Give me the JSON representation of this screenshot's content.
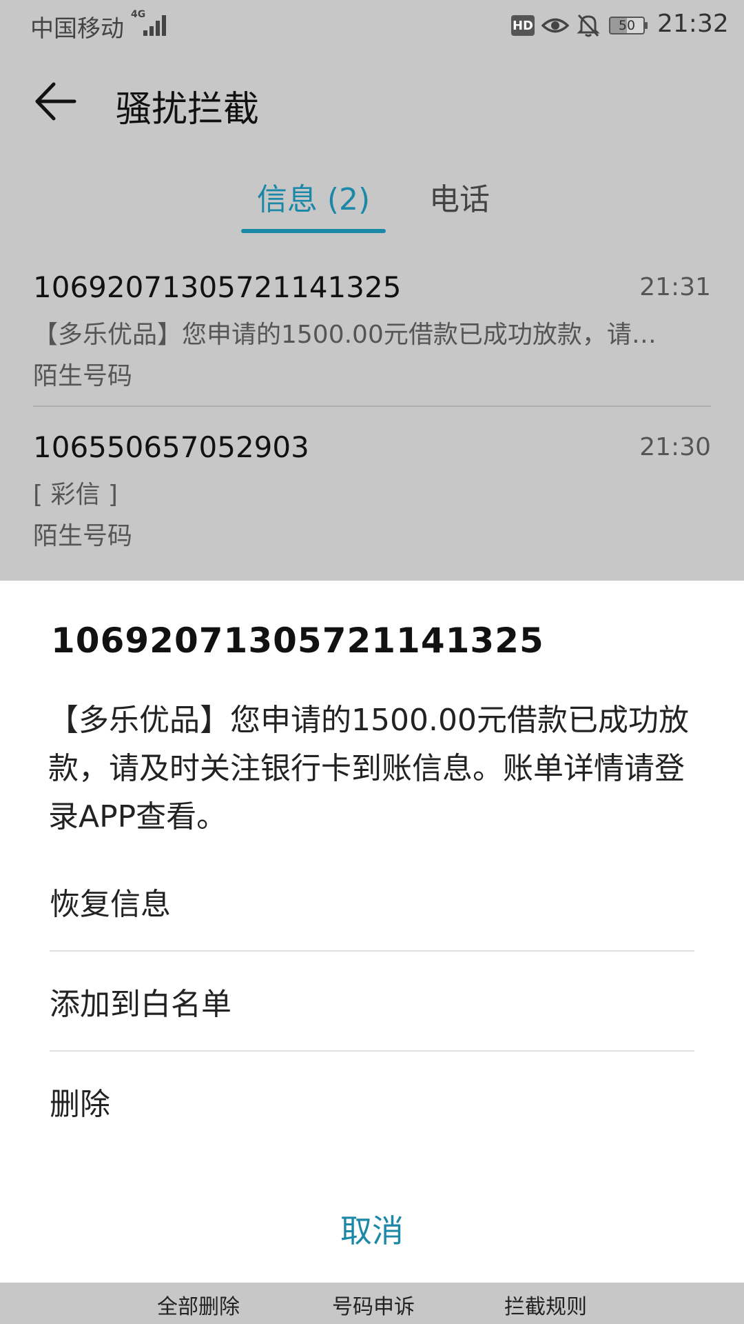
{
  "status_bar": {
    "carrier": "中国移动",
    "network": "4G",
    "hd": "HD",
    "battery_pct": "50",
    "battery_level": 0.5,
    "time": "21:32"
  },
  "app_bar": {
    "title": "骚扰拦截"
  },
  "tabs": [
    {
      "label": "信息 (2)",
      "active": true
    },
    {
      "label": "电话",
      "active": false
    }
  ],
  "messages": [
    {
      "sender": "10692071305721141325",
      "time": "21:31",
      "preview": "【多乐优品】您申请的1500.00元借款已成功放款，请…",
      "tag": "陌生号码"
    },
    {
      "sender": "106550657052903",
      "time": "21:30",
      "preview": "[ 彩信 ]",
      "tag": "陌生号码"
    }
  ],
  "sheet": {
    "sender": "10692071305721141325",
    "body": "【多乐优品】您申请的1500.00元借款已成功放款，请及时关注银行卡到账信息。账单详情请登录APP查看。",
    "options": [
      "恢复信息",
      "添加到白名单",
      "删除"
    ],
    "cancel": "取消"
  },
  "bottom_bar": {
    "actions": [
      "全部删除",
      "号码申诉",
      "拦截规则"
    ]
  },
  "colors": {
    "accent": "#1b88a8",
    "scrim": "#c7c7c7",
    "sheet": "#ffffff"
  }
}
